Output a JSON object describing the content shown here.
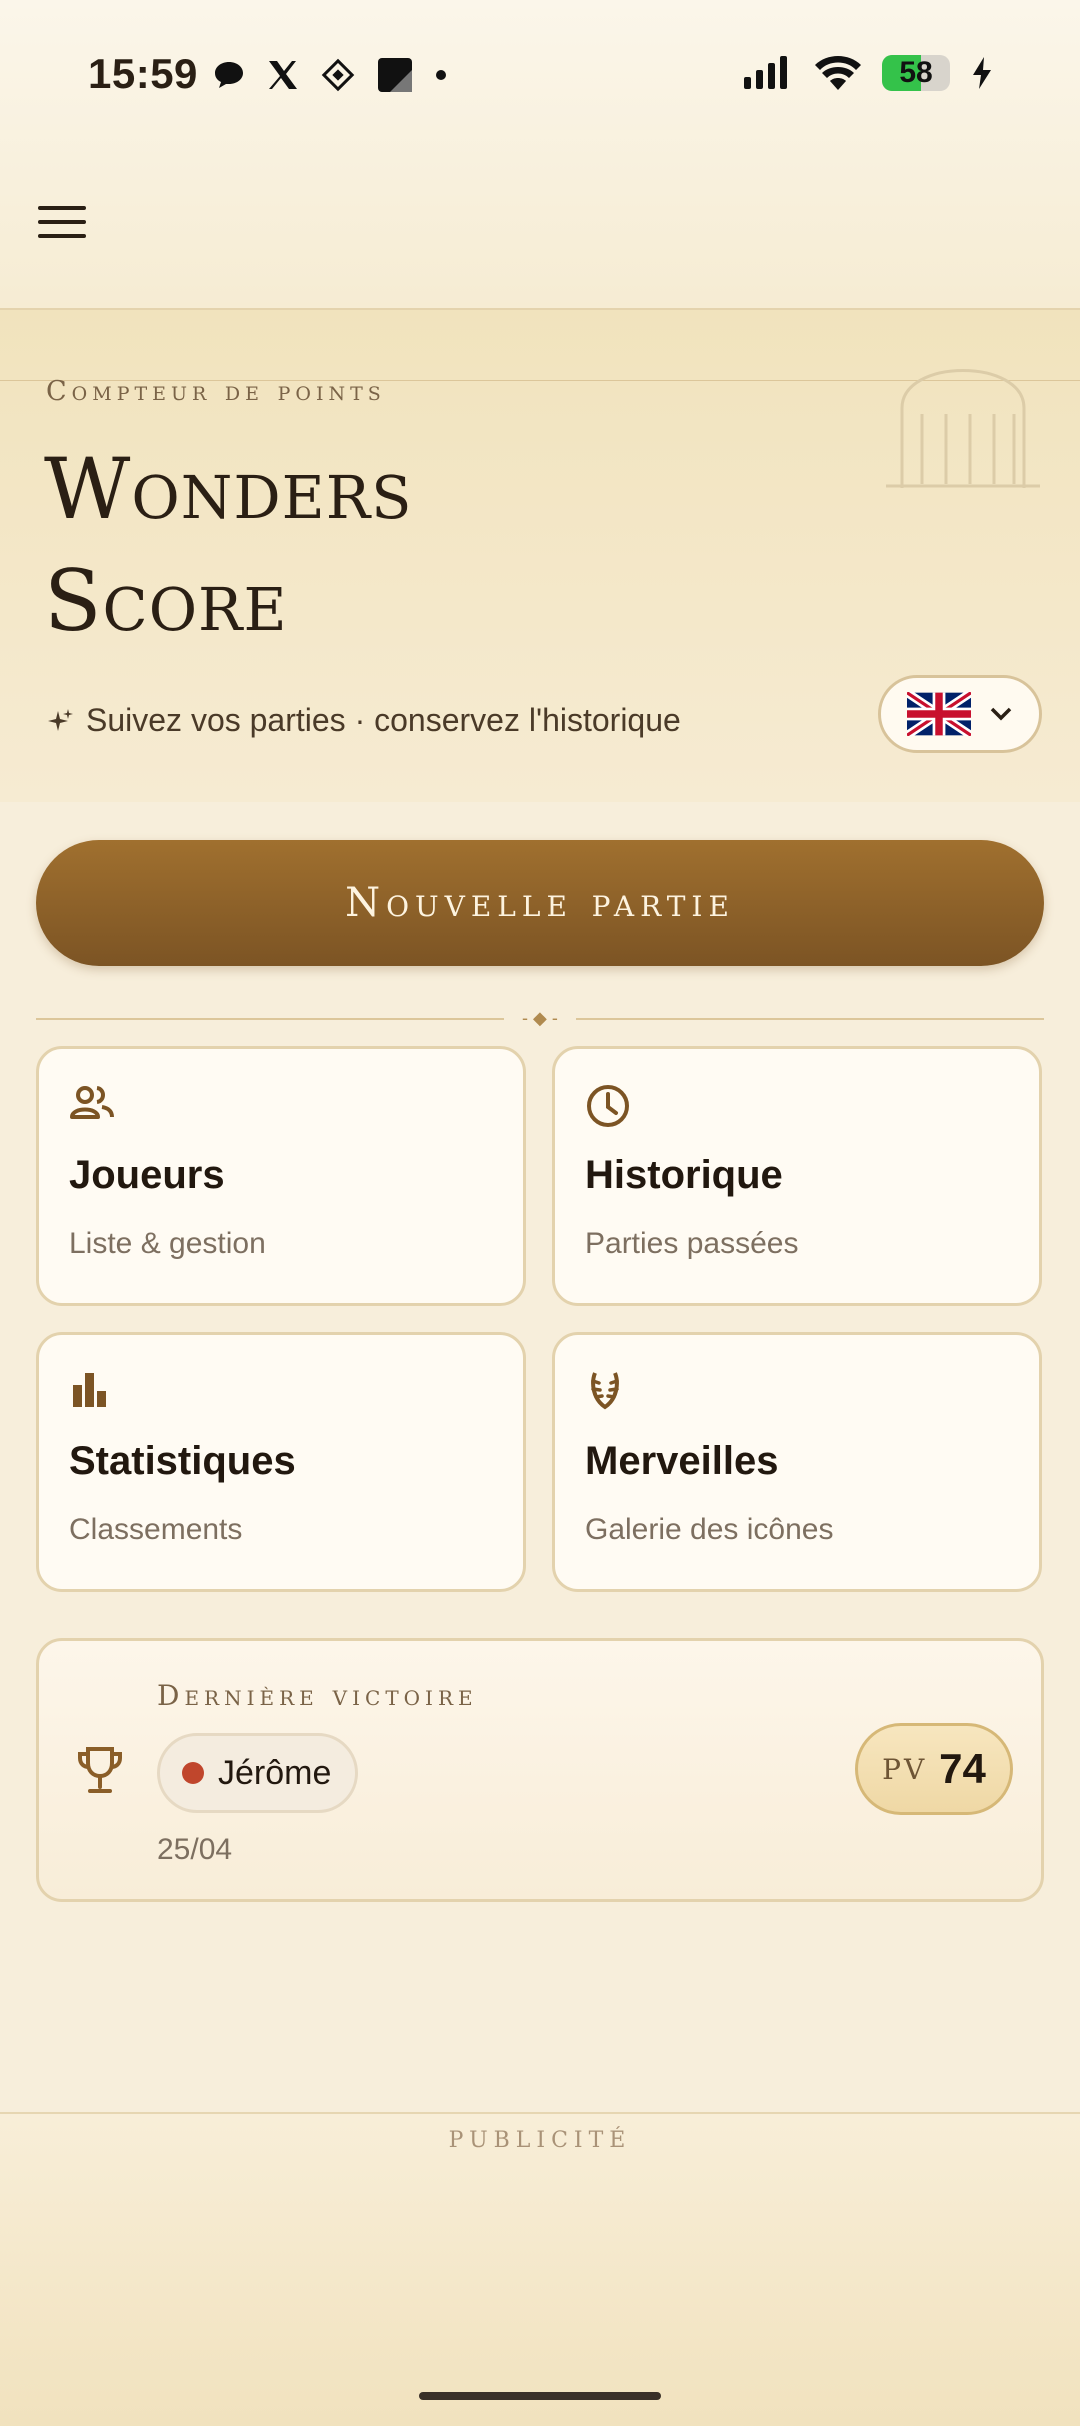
{
  "status_bar": {
    "time": "15:59",
    "battery": "58",
    "icons_left": [
      "chat-bubble-icon",
      "x-logo-icon",
      "app-diamond-icon",
      "square-app-icon",
      "dot-icon"
    ],
    "icons_right": [
      "signal-icon",
      "wifi-icon",
      "battery-icon",
      "charging-icon"
    ]
  },
  "app_bar": {
    "menu_icon": "hamburger-menu-icon"
  },
  "hero": {
    "kicker": "Compteur de points",
    "title_line1": "Wonders",
    "title_line2": "Score",
    "tagline": "Suivez vos parties · conservez l'historique",
    "language_flag": "uk-flag-icon"
  },
  "actions": {
    "new_game_label": "Nouvelle partie"
  },
  "cards": [
    {
      "title": "Joueurs",
      "subtitle": "Liste & gestion",
      "icon": "people-icon"
    },
    {
      "title": "Historique",
      "subtitle": "Parties passées",
      "icon": "clock-icon"
    },
    {
      "title": "Statistiques",
      "subtitle": "Classements",
      "icon": "bar-chart-icon"
    },
    {
      "title": "Merveilles",
      "subtitle": "Galerie des icônes",
      "icon": "laurel-icon"
    }
  ],
  "last_victory": {
    "label": "Dernière victoire",
    "player": "Jérôme",
    "date": "25/04",
    "points_label": "PV",
    "points": "74",
    "player_color": "#c0462c"
  },
  "ad": {
    "label": "PUBLICITÉ"
  },
  "colors": {
    "accent": "#8a5e28",
    "background": "#f7eedb",
    "card_border": "#e3d2ad"
  }
}
